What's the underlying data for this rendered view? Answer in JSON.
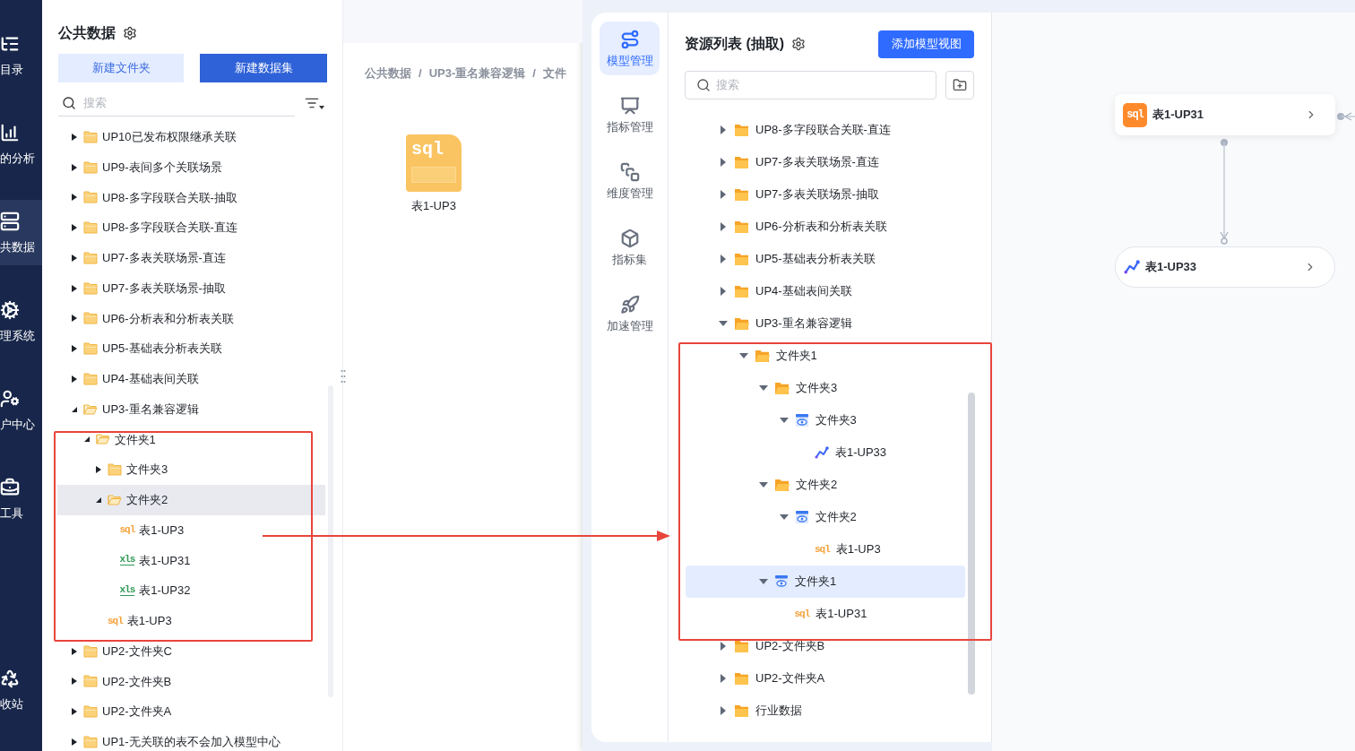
{
  "left_nav": {
    "items": [
      {
        "label": "目录",
        "selected": false
      },
      {
        "label": "的分析",
        "selected": false
      },
      {
        "label": "共数据",
        "selected": true
      },
      {
        "label": "理系统",
        "selected": false
      },
      {
        "label": "户中心",
        "selected": false
      },
      {
        "label": "工具",
        "selected": false
      },
      {
        "label": "收站",
        "selected": false
      }
    ]
  },
  "public_data_panel": {
    "title": "公共数据",
    "buttons": [
      {
        "label": "新建文件夹",
        "kind": "secondary"
      },
      {
        "label": "新建数据集",
        "kind": "primary"
      }
    ],
    "search": {
      "placeholder": "搜索"
    },
    "tree": [
      {
        "label": "UP10已发布权限继承关联",
        "kind": "folder",
        "expanded": false,
        "selected": false
      },
      {
        "label": "UP9-表间多个关联场景",
        "kind": "folder",
        "expanded": false,
        "selected": false
      },
      {
        "label": "UP8-多字段联合关联-抽取",
        "kind": "folder",
        "expanded": false,
        "selected": false
      },
      {
        "label": "UP8-多字段联合关联-直连",
        "kind": "folder",
        "expanded": false,
        "selected": false
      },
      {
        "label": "UP7-多表关联场景-直连",
        "kind": "folder",
        "expanded": false,
        "selected": false
      },
      {
        "label": "UP7-多表关联场景-抽取",
        "kind": "folder",
        "expanded": false,
        "selected": false
      },
      {
        "label": "UP6-分析表和分析表关联",
        "kind": "folder",
        "expanded": false,
        "selected": false
      },
      {
        "label": "UP5-基础表分析表关联",
        "kind": "folder",
        "expanded": false,
        "selected": false
      },
      {
        "label": "UP4-基础表间关联",
        "kind": "folder",
        "expanded": false,
        "selected": false
      },
      {
        "label": "UP3-重名兼容逻辑",
        "kind": "folder",
        "expanded": true,
        "selected": false,
        "children": [
          {
            "label": "文件夹1",
            "kind": "folder",
            "expanded": true,
            "selected": false,
            "children": [
              {
                "label": "文件夹3",
                "kind": "folder",
                "expanded": false,
                "selected": false
              },
              {
                "label": "文件夹2",
                "kind": "folder",
                "expanded": true,
                "selected": true,
                "children": [
                  {
                    "label": "表1-UP3",
                    "kind": "sql",
                    "badge": "sql",
                    "selected": false
                  },
                  {
                    "label": "表1-UP31",
                    "kind": "xls",
                    "badge": "xls",
                    "selected": false
                  },
                  {
                    "label": "表1-UP32",
                    "kind": "xls",
                    "badge": "xls",
                    "selected": false
                  }
                ]
              },
              {
                "label": "表1-UP3",
                "kind": "sql",
                "badge": "sql",
                "selected": false
              }
            ]
          }
        ]
      },
      {
        "label": "UP2-文件夹C",
        "kind": "folder",
        "expanded": false,
        "selected": false
      },
      {
        "label": "UP2-文件夹B",
        "kind": "folder",
        "expanded": false,
        "selected": false
      },
      {
        "label": "UP2-文件夹A",
        "kind": "folder",
        "expanded": false,
        "selected": false
      },
      {
        "label": "UP1-无关联的表不会加入模型中心",
        "kind": "folder",
        "expanded": false,
        "selected": false
      }
    ]
  },
  "content": {
    "breadcrumb": [
      "公共数据",
      "UP3-重名兼容逻辑",
      "文件"
    ],
    "separator": "/",
    "files": [
      {
        "kind": "sql",
        "badge": "sql",
        "label": "表1-UP3"
      }
    ]
  },
  "model_nav": {
    "items": [
      {
        "label": "模型管理",
        "selected": true
      },
      {
        "label": "指标管理",
        "selected": false
      },
      {
        "label": "维度管理",
        "selected": false
      },
      {
        "label": "指标集",
        "selected": false
      },
      {
        "label": "加速管理",
        "selected": false
      }
    ]
  },
  "resource_panel": {
    "title": "资源列表 (抽取)",
    "add_button": "添加模型视图",
    "search": {
      "placeholder": "搜索"
    },
    "tree": [
      {
        "label": "UP8-多字段联合关联-直连",
        "kind": "folder",
        "expanded": false,
        "selected": false
      },
      {
        "label": "UP7-多表关联场景-直连",
        "kind": "folder",
        "expanded": false,
        "selected": false
      },
      {
        "label": "UP7-多表关联场景-抽取",
        "kind": "folder",
        "expanded": false,
        "selected": false
      },
      {
        "label": "UP6-分析表和分析表关联",
        "kind": "folder",
        "expanded": false,
        "selected": false
      },
      {
        "label": "UP5-基础表分析表关联",
        "kind": "folder",
        "expanded": false,
        "selected": false
      },
      {
        "label": "UP4-基础表间关联",
        "kind": "folder",
        "expanded": false,
        "selected": false
      },
      {
        "label": "UP3-重名兼容逻辑",
        "kind": "folder",
        "expanded": true,
        "selected": false,
        "children": [
          {
            "label": "文件夹1",
            "kind": "folder",
            "expanded": true,
            "selected": false,
            "children": [
              {
                "label": "文件夹3",
                "kind": "folder",
                "expanded": true,
                "selected": false,
                "children": [
                  {
                    "label": "文件夹3",
                    "kind": "view",
                    "expanded": true,
                    "selected": false,
                    "children": [
                      {
                        "label": "表1-UP33",
                        "kind": "chart",
                        "selected": false
                      }
                    ]
                  }
                ]
              },
              {
                "label": "文件夹2",
                "kind": "folder",
                "expanded": true,
                "selected": false,
                "children": [
                  {
                    "label": "文件夹2",
                    "kind": "view",
                    "expanded": true,
                    "selected": false,
                    "children": [
                      {
                        "label": "表1-UP3",
                        "kind": "sql",
                        "badge": "sql",
                        "selected": false
                      }
                    ]
                  }
                ]
              },
              {
                "label": "文件夹1",
                "kind": "view",
                "expanded": true,
                "selected": true,
                "children": [
                  {
                    "label": "表1-UP31",
                    "kind": "sql",
                    "badge": "sql",
                    "selected": false
                  }
                ]
              }
            ]
          }
        ]
      },
      {
        "label": "UP2-文件夹B",
        "kind": "folder",
        "expanded": false,
        "selected": false
      },
      {
        "label": "UP2-文件夹A",
        "kind": "folder",
        "expanded": false,
        "selected": false
      },
      {
        "label": "行业数据",
        "kind": "folder",
        "expanded": false,
        "selected": false
      }
    ]
  },
  "canvas": {
    "nodes": [
      {
        "kind": "sql",
        "badge": "sql",
        "label": "表1-UP31"
      },
      {
        "kind": "chart",
        "label": "表1-UP33"
      }
    ]
  }
}
